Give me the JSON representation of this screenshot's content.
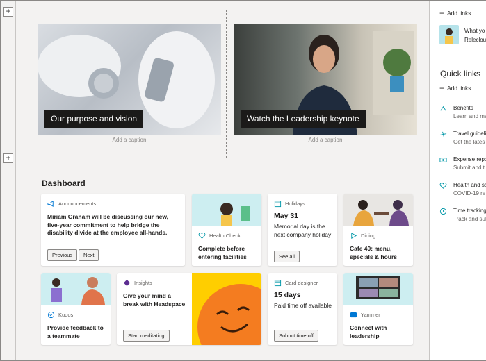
{
  "hero": [
    {
      "title": "Our purpose and vision",
      "caption": "Add a caption"
    },
    {
      "title": "Watch the Leadership keynote",
      "caption": "Add a caption"
    }
  ],
  "dashboard": {
    "title": "Dashboard",
    "announcements": {
      "label": "Announcements",
      "text": "Miriam Graham will be discussing our new, five-year commitment to help bridge the disability divide at the employee all-hands.",
      "prev": "Previous",
      "next": "Next"
    },
    "health_check": {
      "label": "Health Check",
      "text": "Complete before entering facilities"
    },
    "holidays": {
      "label": "Holidays",
      "date": "May 31",
      "text": "Memorial day is the next company holiday",
      "button": "See all"
    },
    "dining": {
      "label": "Dining",
      "text": "Cafe 40: menu, specials & hours"
    },
    "kudos": {
      "label": "Kudos",
      "text": "Provide feedback to a teammate"
    },
    "insights": {
      "label": "Insights",
      "text": "Give your mind a break with Headspace",
      "button": "Start meditating"
    },
    "card_designer": {
      "label": "Card designer",
      "days": "15 days",
      "text": "Paid time off available",
      "button": "Submit time off"
    },
    "yammer": {
      "label": "Yammer",
      "text": "Connect with leadership"
    }
  },
  "pane": {
    "add_links_top": "Add links",
    "news_line1": "What yo",
    "news_line2": "Relecloud",
    "quick_links_title": "Quick links",
    "add_links": "Add links",
    "links": [
      {
        "title": "Benefits",
        "sub": "Learn and ma"
      },
      {
        "title": "Travel guideli",
        "sub": "Get the lates"
      },
      {
        "title": "Expense repo",
        "sub": "Submit and t"
      },
      {
        "title": "Health and sa",
        "sub": "COVID-19 re"
      },
      {
        "title": "Time tracking",
        "sub": "Track and sub"
      }
    ]
  },
  "colors": {
    "accent": "#0078d4",
    "teal": "#0097a7",
    "headspace_orange": "#f47c20",
    "headspace_yellow": "#ffce00"
  }
}
